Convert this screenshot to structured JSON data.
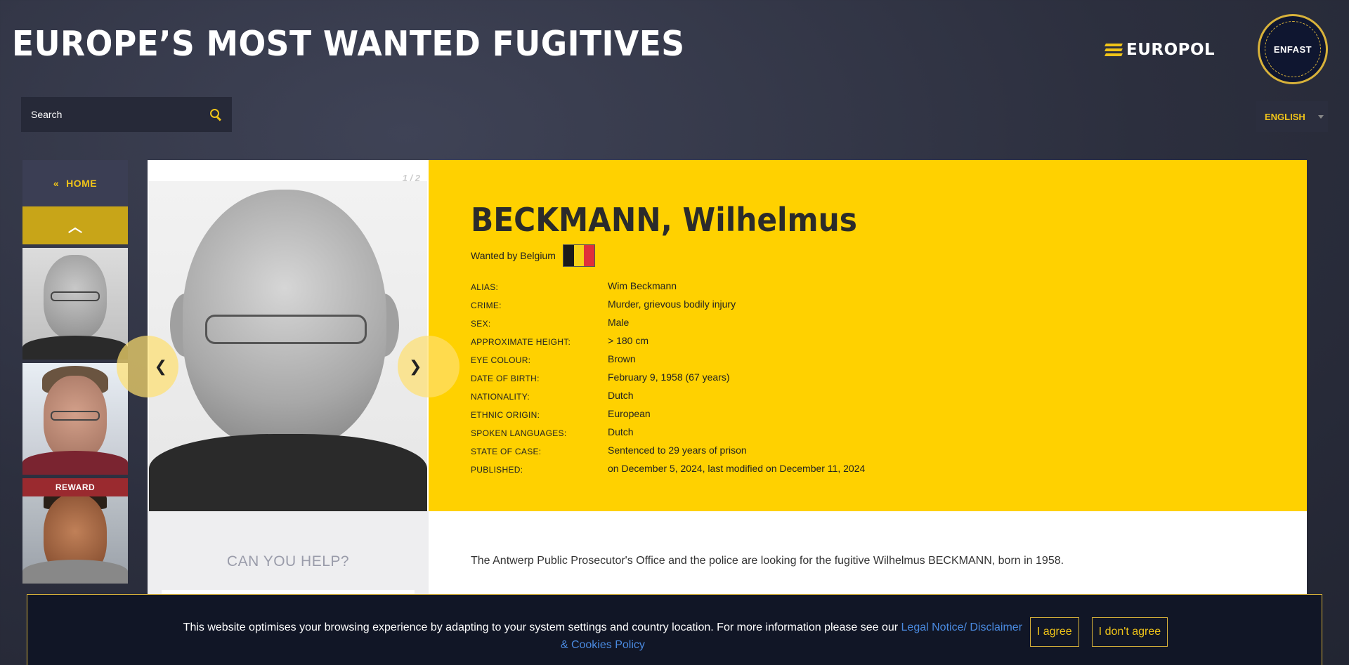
{
  "header": {
    "title": "EUROPE’S MOST WANTED FUGITIVES",
    "europol_logo_text": "EUROPOL",
    "enfast_logo_text": "ENFAST"
  },
  "search": {
    "placeholder": "Search"
  },
  "language": {
    "selected": "ENGLISH"
  },
  "sidebar": {
    "home_label": "HOME",
    "home_icon": "«",
    "up_icon": "︿",
    "reward_label": "REWARD"
  },
  "photo": {
    "counter": "1 / 2",
    "prev_icon": "❮",
    "next_icon": "❯"
  },
  "fugitive": {
    "name": "BECKMANN, Wilhelmus",
    "wanted_by": "Wanted by Belgium",
    "flag_colors": [
      "#1a1a1a",
      "#f7d117",
      "#e0303a"
    ],
    "fields": [
      {
        "label": "ALIAS:",
        "value": "Wim Beckmann"
      },
      {
        "label": "CRIME:",
        "value": "Murder, grievous bodily injury"
      },
      {
        "label": "SEX:",
        "value": "Male"
      },
      {
        "label": "APPROXIMATE HEIGHT:",
        "value": "> 180 cm"
      },
      {
        "label": "EYE COLOUR:",
        "value": "Brown"
      },
      {
        "label": "DATE OF BIRTH:",
        "value": "February 9, 1958 (67 years)"
      },
      {
        "label": "NATIONALITY:",
        "value": "Dutch"
      },
      {
        "label": "ETHNIC ORIGIN:",
        "value": "European"
      },
      {
        "label": "SPOKEN LANGUAGES:",
        "value": "Dutch"
      },
      {
        "label": "STATE OF CASE:",
        "value": "Sentenced to 29 years of prison"
      },
      {
        "label": "PUBLISHED:",
        "value": "on December 5, 2024, last modified on December 11, 2024"
      }
    ]
  },
  "help": {
    "title": "CAN YOU HELP?"
  },
  "description": "The Antwerp Public Prosecutor's Office and the police are looking for the fugitive Wilhelmus BECKMANN, born in 1958.",
  "cookie": {
    "text": "This website optimises your browsing experience by adapting to your system settings and country location. For more information please see our ",
    "link": "Legal Notice/ Disclaimer & Cookies Policy",
    "agree": "I agree",
    "disagree": "I don't agree"
  },
  "colors": {
    "accent_yellow": "#ffd100",
    "dark_bg": "#2c2f3e",
    "reward_red": "#9a2a2f",
    "link_blue": "#4a8ae0"
  }
}
